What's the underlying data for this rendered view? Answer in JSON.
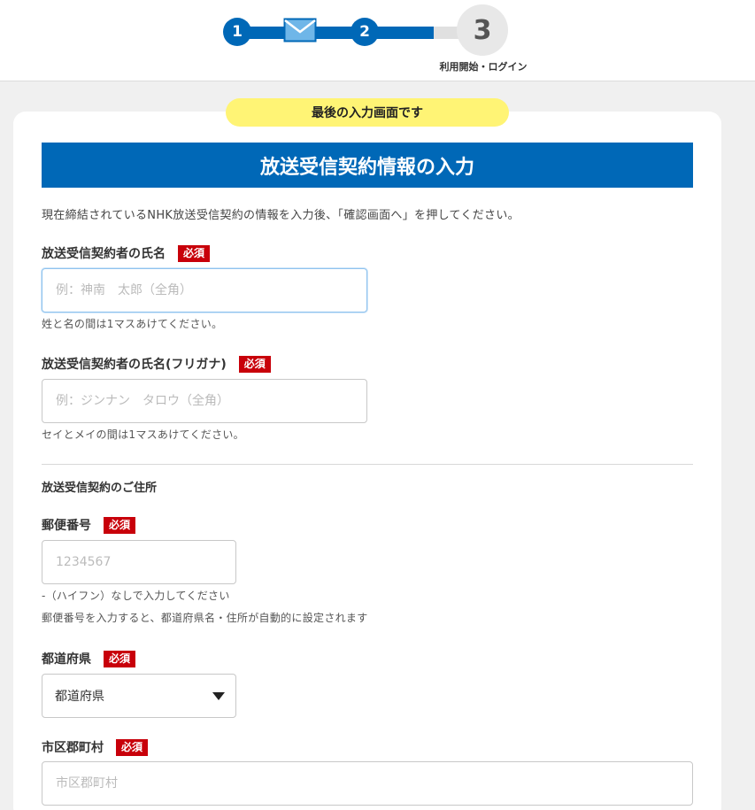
{
  "stepper": {
    "step1": "1",
    "step2": "2",
    "step3": "3",
    "step3_label": "利用開始・ログイン",
    "active_color": "#0068b7",
    "inactive_color": "#e8e8e8"
  },
  "notice": "最後の入力画面です",
  "section_title": "放送受信契約情報の入力",
  "intro": "現在締結されているNHK放送受信契約の情報を入力後、「確認画面へ」を押してください。",
  "required_badge": "必須",
  "fields": {
    "name": {
      "label": "放送受信契約者の氏名",
      "placeholder": "例：神南　太郎（全角）",
      "hint": "姓と名の間は1マスあけてください。"
    },
    "kana": {
      "label": "放送受信契約者の氏名(フリガナ)",
      "placeholder": "例：ジンナン　タロウ（全角）",
      "hint": "セイとメイの間は1マスあけてください。"
    },
    "address_section": "放送受信契約のご住所",
    "postal": {
      "label": "郵便番号",
      "placeholder": "1234567",
      "hint1": "-（ハイフン）なしで入力してください",
      "hint2": "郵便番号を入力すると、都道府県名・住所が自動的に設定されます"
    },
    "prefecture": {
      "label": "都道府県",
      "selected": "都道府県"
    },
    "city": {
      "label": "市区郡町村",
      "placeholder": "市区郡町村"
    }
  }
}
